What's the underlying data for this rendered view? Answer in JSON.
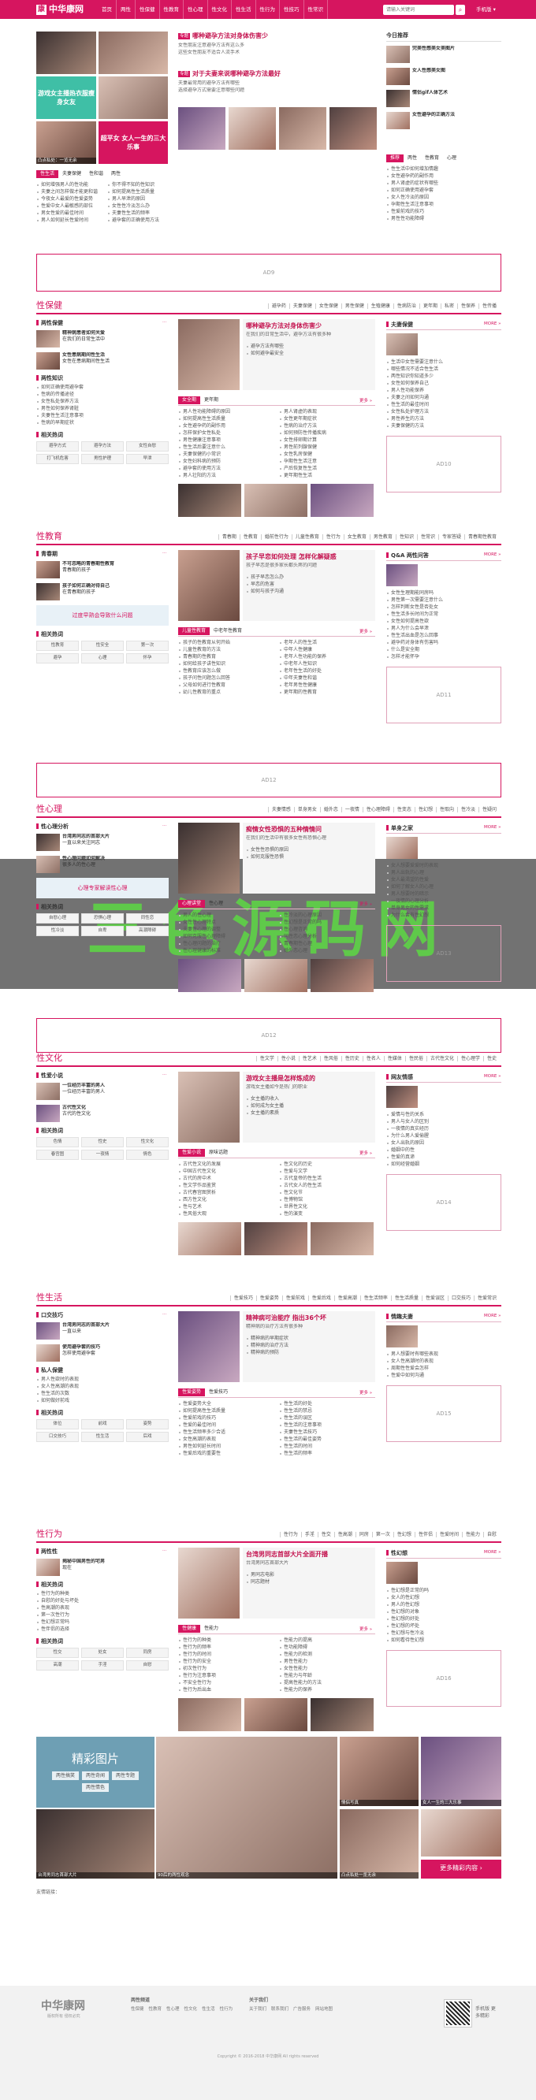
{
  "site": {
    "logo_text": "中华康网",
    "nav": [
      "首页",
      "两性",
      "性保健",
      "性教育",
      "性心理",
      "性文化",
      "性生活",
      "性行为",
      "性技巧",
      "性常识"
    ],
    "search_placeholder": "请输入关键词",
    "top_right": "手机版",
    "brand_color": "#d6155f"
  },
  "hero": {
    "left_photos": [
      "",
      "",
      "凸点私处：一览无余",
      "",
      ""
    ],
    "tiles": [
      "游戏女主播热衣服瘦身女友",
      "超平女 女人一生的三大乐事"
    ],
    "center_headlines": [
      {
        "tag": "专题",
        "title": "哪种避孕方法对身体伤害少",
        "lines": [
          "女性朋友注意避孕方法有这么多",
          "这些女性朋友不适合人流手术"
        ]
      },
      {
        "tag": "专题",
        "title": "对于夫妻来说哪种避孕方法最好",
        "lines": [
          "夫妻最常用的避孕方法有哪些",
          "选择避孕方式需要注意哪些问题"
        ]
      }
    ],
    "center_photos": [
      "",
      "",
      "",
      "",
      "",
      "",
      "",
      ""
    ],
    "right_title": "今日推荐",
    "right_items": [
      "完美性感美女美图片",
      "女人性感美女图",
      "情侣gif人体艺术",
      "女性避孕的正确方法"
    ]
  },
  "hot_tabs": [
    "性生活",
    "夫妻保健",
    "性和谐",
    "两性"
  ],
  "hot_list_a": [
    "如何增强男人的性功能",
    "夫妻之间怎样做才能更和谐",
    "今夜女人最爱的性爱姿势",
    "性爱中女人最敏感的部位",
    "男女性爱的最佳时间",
    "男人如何延长性爱时间"
  ],
  "hot_list_b": [
    "你不得不知的性知识",
    "如何提高性生活质量",
    "男人早泄的原因",
    "女性性冷淡怎么办",
    "夫妻性生活的频率",
    "避孕套的正确使用方法"
  ],
  "right_tabs": [
    "推荐",
    "两性",
    "性教育",
    "心理"
  ],
  "right_tab_list": [
    "性生活中如何增加情趣",
    "女性避孕药的副作用",
    "男人肾虚的症状有哪些",
    "如何正确使用避孕套",
    "女人性冷淡的原因",
    "孕期性生活注意事项",
    "性爱前戏的技巧",
    "男性性功能障碍"
  ],
  "ads": [
    "AD9",
    "AD10",
    "AD11",
    "AD12",
    "AD13",
    "AD12",
    "AD14",
    "AD15",
    "AD16"
  ],
  "sections": [
    {
      "title": "性保健",
      "links": [
        "避孕药",
        "夫妻保健",
        "女性保健",
        "男性保健",
        "生殖健康",
        "性病防治",
        "更年期",
        "私密",
        "性保养",
        "性传播"
      ],
      "left_box": "两性保健",
      "left_items": [
        {
          "t": "精神病患者如何关爱",
          "s": "在我们的日常生活中"
        },
        {
          "t": "女性患病期间性生活",
          "s": "女性在患病期间性生活"
        }
      ],
      "left_box2": "两性知识",
      "left_list": [
        "如何正确使用避孕套",
        "性病的传播途径",
        "女性私处保养方法",
        "男性如何保养肾脏",
        "夫妻性生活注意事项",
        "性病的早期症状"
      ],
      "hot_label": "相关热词",
      "hot": [
        "避孕方式",
        "避孕方法",
        "女性自慰",
        "打飞机危害",
        "男性护理",
        "早泄"
      ],
      "center_title": "哪种避孕方法对身体伤害少",
      "center_desc": "在我们的日常生活中，避孕方法有很多种",
      "center_list": [
        "避孕方法有哪些",
        "如何避孕最安全"
      ],
      "tabs": [
        "女全期",
        "更年期"
      ],
      "center_list2": [
        "男人性功能障碍的原因",
        "如何提高性生活质量",
        "女性避孕药的副作用",
        "怎样保护女性私处",
        "男性健康注意事项",
        "性生活后要注意什么",
        "夫妻保健的小常识",
        "女性妇科病的预防",
        "避孕套的使用方法",
        "男人壮阳的方法"
      ],
      "center_list3": [
        "男人肾虚的表现",
        "女性更年期症状",
        "性病的治疗方法",
        "如何预防性传播疾病",
        "女性排卵期计算",
        "男性前列腺保健",
        "女性乳房保健",
        "孕期性生活注意",
        "产后恢复性生活",
        "更年期性生活"
      ],
      "right_box": "夫妻保健",
      "right_list": [
        "生活中女性需要注意什么",
        "哪些情况不适合性生活",
        "两性知识你知道多少",
        "女性如何保养自己",
        "男人性功能保养",
        "夫妻之间如何沟通",
        "性生活的最佳时间",
        "女性私处护理方法",
        "男性养生的方法",
        "夫妻保健的方法"
      ]
    },
    {
      "title": "性教育",
      "links": [
        "青春期",
        "性教育",
        "婚前性行为",
        "儿童性教育",
        "性行为",
        "女生教育",
        "男性教育",
        "性知识",
        "性常识",
        "专家答疑",
        "青春期性教育"
      ],
      "left_box": "青春期",
      "left_items": [
        {
          "t": "不可忽略的青春期性教育",
          "s": "青春期的孩子"
        },
        {
          "t": "孩子如何正确对待自己",
          "s": "在青春期的孩子"
        }
      ],
      "left_box2": "专家观点",
      "banner": "过度早熟会导致什么问题",
      "hot_label": "相关热词",
      "hot": [
        "性教育",
        "性安全",
        "第一次",
        "避孕",
        "心理",
        "怀孕"
      ],
      "center_title": "孩子早恋如何处理 怎样化解疑惑",
      "center_desc": "孩子早恋是很多家长都头疼的问题",
      "center_list": [
        "孩子早恋怎么办",
        "早恋的危害",
        "如何与孩子沟通"
      ],
      "tabs": [
        "儿童性教育",
        "中老年性教育"
      ],
      "center_list2": [
        "孩子的性教育从何开始",
        "儿童性教育的方法",
        "青春期的性教育",
        "如何给孩子讲性知识",
        "性教育应该怎么做",
        "孩子问性问题怎么回答",
        "父母如何进行性教育",
        "幼儿性教育的重点"
      ],
      "center_list3": [
        "老年人的性生活",
        "中年人性健康",
        "老年人性功能的保养",
        "中老年人性知识",
        "老年性生活的好处",
        "中年夫妻性和谐",
        "老年男性性健康",
        "更年期的性教育"
      ],
      "right_box": "Q&A 两性问答",
      "right_list": [
        "女性生理期能同房吗",
        "男性第一次需要注意什么",
        "怎样判断女性是否处女",
        "性生活多长时间为正常",
        "女性如何提高性欲",
        "男人为什么会早泄",
        "性生活出血是怎么回事",
        "避孕药对身体有伤害吗",
        "什么是安全期",
        "怎样才能怀孕"
      ]
    },
    {
      "title": "性心理",
      "links": [
        "夫妻情感",
        "单身男女",
        "婚外恋",
        "一夜情",
        "性心理障碍",
        "性变态",
        "性幻想",
        "性取向",
        "性冷淡",
        "性疑问"
      ],
      "left_box": "性心理分析",
      "left_items": [
        {
          "t": "台湾男同志的首部大片",
          "s": "一直以来关注同志"
        },
        {
          "t": "性心理问题如何解决",
          "s": "很多人的性心理"
        }
      ],
      "left_box2": "心理百科",
      "banner": "心理专家解读性心理",
      "hot_label": "相关热词",
      "hot": [
        "自慰心理",
        "恐惧心理",
        "同性恋",
        "性冷淡",
        "自卑",
        "高潮障碍"
      ],
      "center_title": "痴情女性恐惧的五种情情问",
      "center_desc": "在我们的生活中有很多女性有恐惧心理",
      "center_list": [
        "女性性恐惧的原因",
        "如何克服性恐惧"
      ],
      "tabs": [
        "心理讲堂",
        "性心理"
      ],
      "center_list2": [
        "男人的性心理",
        "女性性心理特点",
        "夫妻性心理的调整",
        "如何克服性心理障碍",
        "性心理问题的治疗",
        "性心理健康的标准"
      ],
      "center_list3": [
        "性冷淡的心理原因",
        "性幻想是正常的吗",
        "性心理咨询",
        "同性恋心理分析",
        "青春期性心理",
        "婚外恋心理"
      ],
      "right_box": "单身之家",
      "right_list": [
        "女人想要爱爱时的表现",
        "男人出轨的心理",
        "女人最渴望的性爱",
        "如何了解女人的心理",
        "男人想要时的暗示",
        "一夜情的心理分析",
        "单身男女的性需求",
        "为什么会有性幻想"
      ]
    },
    {
      "title": "性文化",
      "links": [
        "性文学",
        "性小说",
        "性艺术",
        "性风俗",
        "性历史",
        "性名人",
        "性媒体",
        "性民俗",
        "古代性文化",
        "性心理学",
        "性史"
      ],
      "left_box": "性爱小说",
      "left_items": [
        {
          "t": "一位经历丰富的男人",
          "s": "一位经历丰富的男人"
        },
        {
          "t": "古代性文化",
          "s": "古代的性文化"
        }
      ],
      "left_box2": "相关热词",
      "hot_label": "相关热词",
      "hot": [
        "色情",
        "性史",
        "性文化",
        "春宫图",
        "一夜情",
        "情色"
      ],
      "center_title": "游戏女主播是怎样炼成的",
      "center_desc": "游戏女主播如今是热门的职业",
      "center_list": [
        "女主播的收入",
        "如何成为女主播",
        "女主播的素质"
      ],
      "tabs": [
        "性爱小说",
        "原味话题"
      ],
      "center_list2": [
        "古代性文化的发展",
        "中国古代性文化",
        "古代的房中术",
        "性文学作品鉴赏",
        "古代春宫图赏析",
        "西方性文化",
        "性与艺术",
        "性风俗大观"
      ],
      "center_list3": [
        "性文化的历史",
        "性爱与文学",
        "古代皇帝的性生活",
        "古代女人的性生活",
        "性文化节",
        "性博物馆",
        "世界性文化",
        "性的演变"
      ],
      "right_box": "网友情感",
      "right_list": [
        "爱情与性的关系",
        "男人与女人的区别",
        "一夜情的真实经历",
        "为什么男人爱偷腥",
        "女人出轨的原因",
        "婚姻中的性",
        "性爱的真谛",
        "如何经营婚姻"
      ]
    },
    {
      "title": "性生活",
      "links": [
        "性爱技巧",
        "性爱姿势",
        "性爱前戏",
        "性爱后戏",
        "性爱高潮",
        "性生活频率",
        "性生活质量",
        "性爱误区",
        "口交技巧",
        "性爱常识"
      ],
      "left_box": "口交技巧",
      "left_items": [
        {
          "t": "台湾男同志的首部大片",
          "s": "一直以来"
        },
        {
          "t": "使用避孕套的技巧",
          "s": "怎样使用避孕套"
        }
      ],
      "left_box2": "私人保健",
      "left_list": [
        "男人性欲时的表现",
        "女人性高潮的表现",
        "性生活的次数",
        "如何做好前戏"
      ],
      "hot_label": "相关热词",
      "hot": [
        "体位",
        "前戏",
        "姿势",
        "口交技巧",
        "性生活",
        "后戏"
      ],
      "center_title": "精神病可治能疗 指出36个坏",
      "center_desc": "精神病的治疗方法有很多种",
      "center_list": [
        "精神病的早期症状",
        "精神病的治疗方法",
        "精神病的预防"
      ],
      "tabs": [
        "性爱姿势",
        "性爱技巧"
      ],
      "center_list2": [
        "性爱姿势大全",
        "如何提高性生活质量",
        "性爱前戏的技巧",
        "性爱的最佳时间",
        "性生活频率多少合适",
        "女性高潮的表现",
        "男性如何延长时间",
        "性爱后戏的重要性"
      ],
      "center_list3": [
        "性生活的好处",
        "性生活的禁忌",
        "性生活的误区",
        "性生活的注意事项",
        "夫妻性生活技巧",
        "性生活的最佳姿势",
        "性生活的时间",
        "性生活的频率"
      ],
      "right_box": "情趣夫妻",
      "right_list": [
        "男人想要时有哪些表现",
        "女人性高潮时的表现",
        "周期性性爱会怎样",
        "性爱中如何沟通"
      ]
    },
    {
      "title": "性行为",
      "links": [
        "性行为",
        "手淫",
        "性交",
        "性高潮",
        "同房",
        "第一次",
        "性幻想",
        "性伴侣",
        "性爱时间",
        "性能力",
        "自慰"
      ],
      "left_box": "两性性",
      "left_items": [
        {
          "t": "揭秘中国男性的宅男",
          "s": "现在"
        }
      ],
      "left_box2": "相关热词",
      "left_list": [
        "性行为的种类",
        "自慰的好处与坏处",
        "性高潮的表现",
        "第一次性行为",
        "性幻想正常吗",
        "性伴侣的选择"
      ],
      "hot_label": "相关热词",
      "hot": [
        "性交",
        "处女",
        "同房",
        "高潮",
        "手淫",
        "自慰"
      ],
      "center_title": "台湾男同志首部大片全面开播",
      "center_desc": "台湾男同志首部大片",
      "center_list": [
        "男同志电影",
        "同志题材"
      ],
      "tabs": [
        "性健康",
        "性能力"
      ],
      "center_list2": [
        "性行为的种类",
        "性行为的频率",
        "性行为的时间",
        "性行为的安全",
        "初次性行为",
        "性行为注意事项",
        "不安全性行为",
        "性行为后出血"
      ],
      "center_list3": [
        "性能力的提高",
        "性功能障碍",
        "性能力的检测",
        "男性性能力",
        "女性性能力",
        "性能力与年龄",
        "提高性能力的方法",
        "性能力的保养"
      ],
      "right_box": "性幻想",
      "right_list": [
        "性幻想是正常的吗",
        "女人的性幻想",
        "男人的性幻想",
        "性幻想的对象",
        "性幻想的好处",
        "性幻想的坏处",
        "性幻想与性冷淡",
        "如何看待性幻想"
      ]
    }
  ],
  "gallery": {
    "title": "精彩图片",
    "buttons": [
      "两性搞笑",
      "两性奇闻",
      "两性专题",
      "两性情色"
    ],
    "photos": [
      "",
      "",
      "",
      "",
      "",
      "",
      "",
      ""
    ],
    "captions": [
      "台湾男同志首部大片",
      "90后的两性观念",
      "情侣写真",
      "凸点私处一览无余",
      "女人一生的三大乐事",
      "更多精彩内容"
    ],
    "more": "更多精彩内容"
  },
  "footer": {
    "logo": "中华康网",
    "sub": "版权所有 侵权必究",
    "cols": [
      "两性频道",
      "关于我们"
    ],
    "links": [
      "性保健",
      "性教育",
      "性心理",
      "性文化",
      "性生活",
      "性行为",
      "关于我们",
      "联系我们",
      "广告服务",
      "网站地图"
    ],
    "copyright": "Copyright © 2016-2018 中华康网 All rights reserved",
    "qr_label": "手机版 更多精彩"
  },
  "watermark": "三色源码网",
  "friend_links_label": "友情链接："
}
